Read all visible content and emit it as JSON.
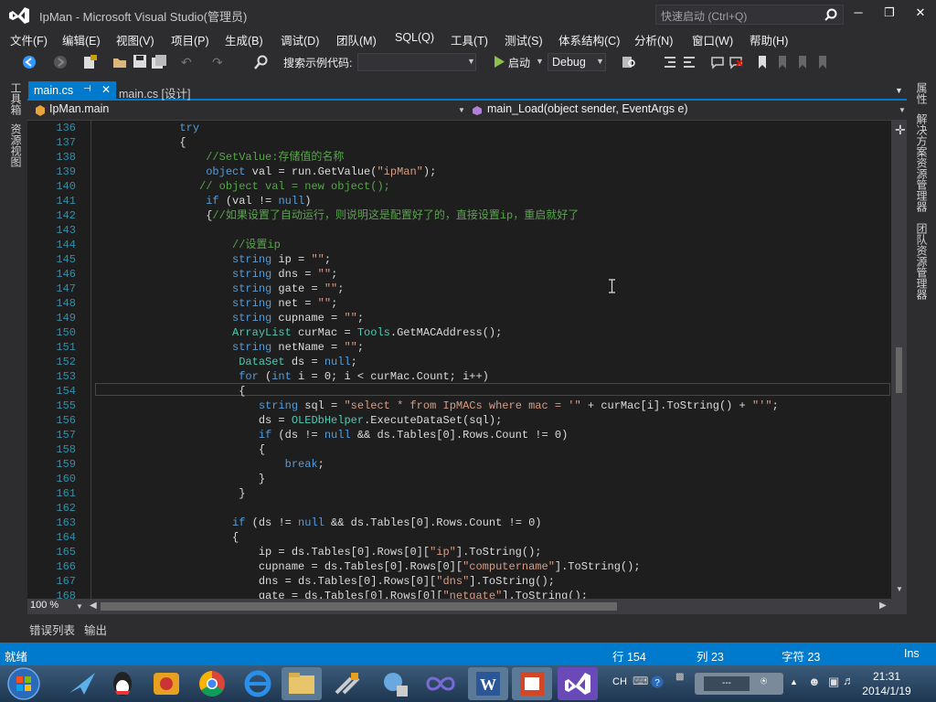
{
  "window": {
    "title": "IpMan - Microsoft Visual Studio(管理员)",
    "quick_launch_placeholder": "快速启动 (Ctrl+Q)"
  },
  "menu": [
    "文件(F)",
    "编辑(E)",
    "视图(V)",
    "项目(P)",
    "生成(B)",
    "调试(D)",
    "团队(M)",
    "SQL(Q)",
    "工具(T)",
    "测试(S)",
    "体系结构(C)",
    "分析(N)",
    "窗口(W)",
    "帮助(H)"
  ],
  "toolbar": {
    "search_label": "搜索示例代码:",
    "start_label": "启动",
    "config": "Debug"
  },
  "left_sidebar": [
    "工具箱",
    "资源视图"
  ],
  "right_sidebar": [
    "属性",
    "解决方案资源管理器",
    "团队资源管理器"
  ],
  "tabs": [
    {
      "label": "main.cs",
      "active": true
    },
    {
      "label": "main.cs [设计]",
      "active": false
    }
  ],
  "navbar": {
    "class_combo": "IpMan.main",
    "member_combo": "main_Load(object sender, EventArgs e)"
  },
  "code_lines": [
    {
      "n": "136",
      "t": [
        [
          "kw",
          "            try"
        ]
      ]
    },
    {
      "n": "137",
      "t": [
        [
          "",
          "            {"
        ]
      ]
    },
    {
      "n": "138",
      "t": [
        [
          "cm",
          "                //SetValue:存储值的名称"
        ]
      ]
    },
    {
      "n": "139",
      "t": [
        [
          "kw",
          "                object"
        ],
        [
          "",
          " val = run.GetValue("
        ],
        [
          "st",
          "\"ipMan\""
        ],
        [
          "",
          ");"
        ]
      ]
    },
    {
      "n": "140",
      "t": [
        [
          "cm",
          "               // object val = new object();"
        ]
      ]
    },
    {
      "n": "141",
      "t": [
        [
          "kw",
          "                if"
        ],
        [
          "",
          " (val != "
        ],
        [
          "kw",
          "null"
        ],
        [
          "",
          ")"
        ]
      ]
    },
    {
      "n": "142",
      "t": [
        [
          "",
          "                {"
        ],
        [
          "cm",
          "//如果设置了自动运行，则说明这是配置好了的，直接设置ip，重启就好了"
        ]
      ]
    },
    {
      "n": "143",
      "t": [
        [
          "",
          ""
        ]
      ]
    },
    {
      "n": "144",
      "t": [
        [
          "cm",
          "                    //设置ip"
        ]
      ]
    },
    {
      "n": "145",
      "t": [
        [
          "kw",
          "                    string"
        ],
        [
          "",
          " ip = "
        ],
        [
          "st",
          "\"\""
        ],
        [
          ";"
        ]
      ]
    },
    {
      "n": "146",
      "t": [
        [
          "kw",
          "                    string"
        ],
        [
          "",
          " dns = "
        ],
        [
          "st",
          "\"\""
        ],
        [
          "",
          ";"
        ]
      ]
    },
    {
      "n": "147",
      "t": [
        [
          "kw",
          "                    string"
        ],
        [
          "",
          " gate = "
        ],
        [
          "st",
          "\"\""
        ],
        [
          "",
          ";"
        ]
      ]
    },
    {
      "n": "148",
      "t": [
        [
          "kw",
          "                    string"
        ],
        [
          "",
          " net = "
        ],
        [
          "st",
          "\"\""
        ],
        [
          "",
          ";"
        ]
      ]
    },
    {
      "n": "149",
      "t": [
        [
          "kw",
          "                    string"
        ],
        [
          "",
          " cupname = "
        ],
        [
          "st",
          "\"\""
        ],
        [
          "",
          ";"
        ]
      ]
    },
    {
      "n": "150",
      "t": [
        [
          "ty",
          "                    ArrayList"
        ],
        [
          "",
          " curMac = "
        ],
        [
          "ty",
          "Tools"
        ],
        [
          "",
          ".GetMACAddress();"
        ]
      ]
    },
    {
      "n": "151",
      "t": [
        [
          "kw",
          "                    string"
        ],
        [
          "",
          " netName = "
        ],
        [
          "st",
          "\"\""
        ],
        [
          "",
          ";"
        ]
      ]
    },
    {
      "n": "152",
      "t": [
        [
          "ty",
          "                     DataSet"
        ],
        [
          "",
          " ds = "
        ],
        [
          "kw",
          "null"
        ],
        [
          "",
          ";"
        ]
      ]
    },
    {
      "n": "153",
      "t": [
        [
          "kw",
          "                     for"
        ],
        [
          "",
          " ("
        ],
        [
          "kw",
          "int"
        ],
        [
          "",
          " i = 0; i < curMac.Count; i++)"
        ]
      ]
    },
    {
      "n": "154",
      "t": [
        [
          "",
          "                     {"
        ]
      ]
    },
    {
      "n": "155",
      "t": [
        [
          "kw",
          "                        string"
        ],
        [
          "",
          " sql = "
        ],
        [
          "st",
          "\"select * from IpMACs where mac = '\""
        ],
        [
          "",
          " + curMac[i].ToString() + "
        ],
        [
          "st",
          "\"'\""
        ],
        [
          "",
          ";"
        ]
      ]
    },
    {
      "n": "156",
      "t": [
        [
          "",
          "                        ds = "
        ],
        [
          "ty",
          "OLEDbHelper"
        ],
        [
          "",
          ".ExecuteDataSet(sql);"
        ]
      ]
    },
    {
      "n": "157",
      "t": [
        [
          "kw",
          "                        if"
        ],
        [
          "",
          " (ds != "
        ],
        [
          "kw",
          "null"
        ],
        [
          "",
          " && ds.Tables[0].Rows.Count != 0)"
        ]
      ]
    },
    {
      "n": "158",
      "t": [
        [
          "",
          "                        {"
        ]
      ]
    },
    {
      "n": "159",
      "t": [
        [
          "kw",
          "                            break"
        ],
        [
          "",
          ";"
        ]
      ]
    },
    {
      "n": "160",
      "t": [
        [
          "",
          "                        }"
        ]
      ]
    },
    {
      "n": "161",
      "t": [
        [
          "",
          "                     }"
        ]
      ]
    },
    {
      "n": "162",
      "t": [
        [
          "",
          ""
        ]
      ]
    },
    {
      "n": "163",
      "t": [
        [
          "kw",
          "                    if"
        ],
        [
          "",
          " (ds != "
        ],
        [
          "kw",
          "null"
        ],
        [
          "",
          " && ds.Tables[0].Rows.Count != 0)"
        ]
      ]
    },
    {
      "n": "164",
      "t": [
        [
          "",
          "                    {"
        ]
      ]
    },
    {
      "n": "165",
      "t": [
        [
          "",
          "                        ip = ds.Tables[0].Rows[0]["
        ],
        [
          "st",
          "\"ip\""
        ],
        [
          "",
          "].ToString();"
        ]
      ]
    },
    {
      "n": "166",
      "t": [
        [
          "",
          "                        cupname = ds.Tables[0].Rows[0]["
        ],
        [
          "st",
          "\"computername\""
        ],
        [
          "",
          "].ToString();"
        ]
      ]
    },
    {
      "n": "167",
      "t": [
        [
          "",
          "                        dns = ds.Tables[0].Rows[0]["
        ],
        [
          "st",
          "\"dns\""
        ],
        [
          "",
          "].ToString();"
        ]
      ]
    },
    {
      "n": "168",
      "t": [
        [
          "",
          "                        gate = ds.Tables[0].Rows[0]["
        ],
        [
          "st",
          "\"netgate\""
        ],
        [
          "",
          "].ToString();"
        ]
      ]
    }
  ],
  "zoom": "100 %",
  "bottom_tabs": [
    "错误列表",
    "输出"
  ],
  "status": {
    "ready": "就绪",
    "line": "行 154",
    "col": "列 23",
    "ch": "字符 23",
    "mode": "Ins"
  },
  "taskbar": {
    "lang": "CH",
    "time": "21:31",
    "date": "2014/1/19"
  },
  "colors": {
    "accent": "#007acc",
    "editor_bg": "#1e1e1e",
    "keyword": "#569cd6",
    "comment": "#57a64a",
    "string": "#d69d85",
    "type": "#4ec9b0"
  }
}
